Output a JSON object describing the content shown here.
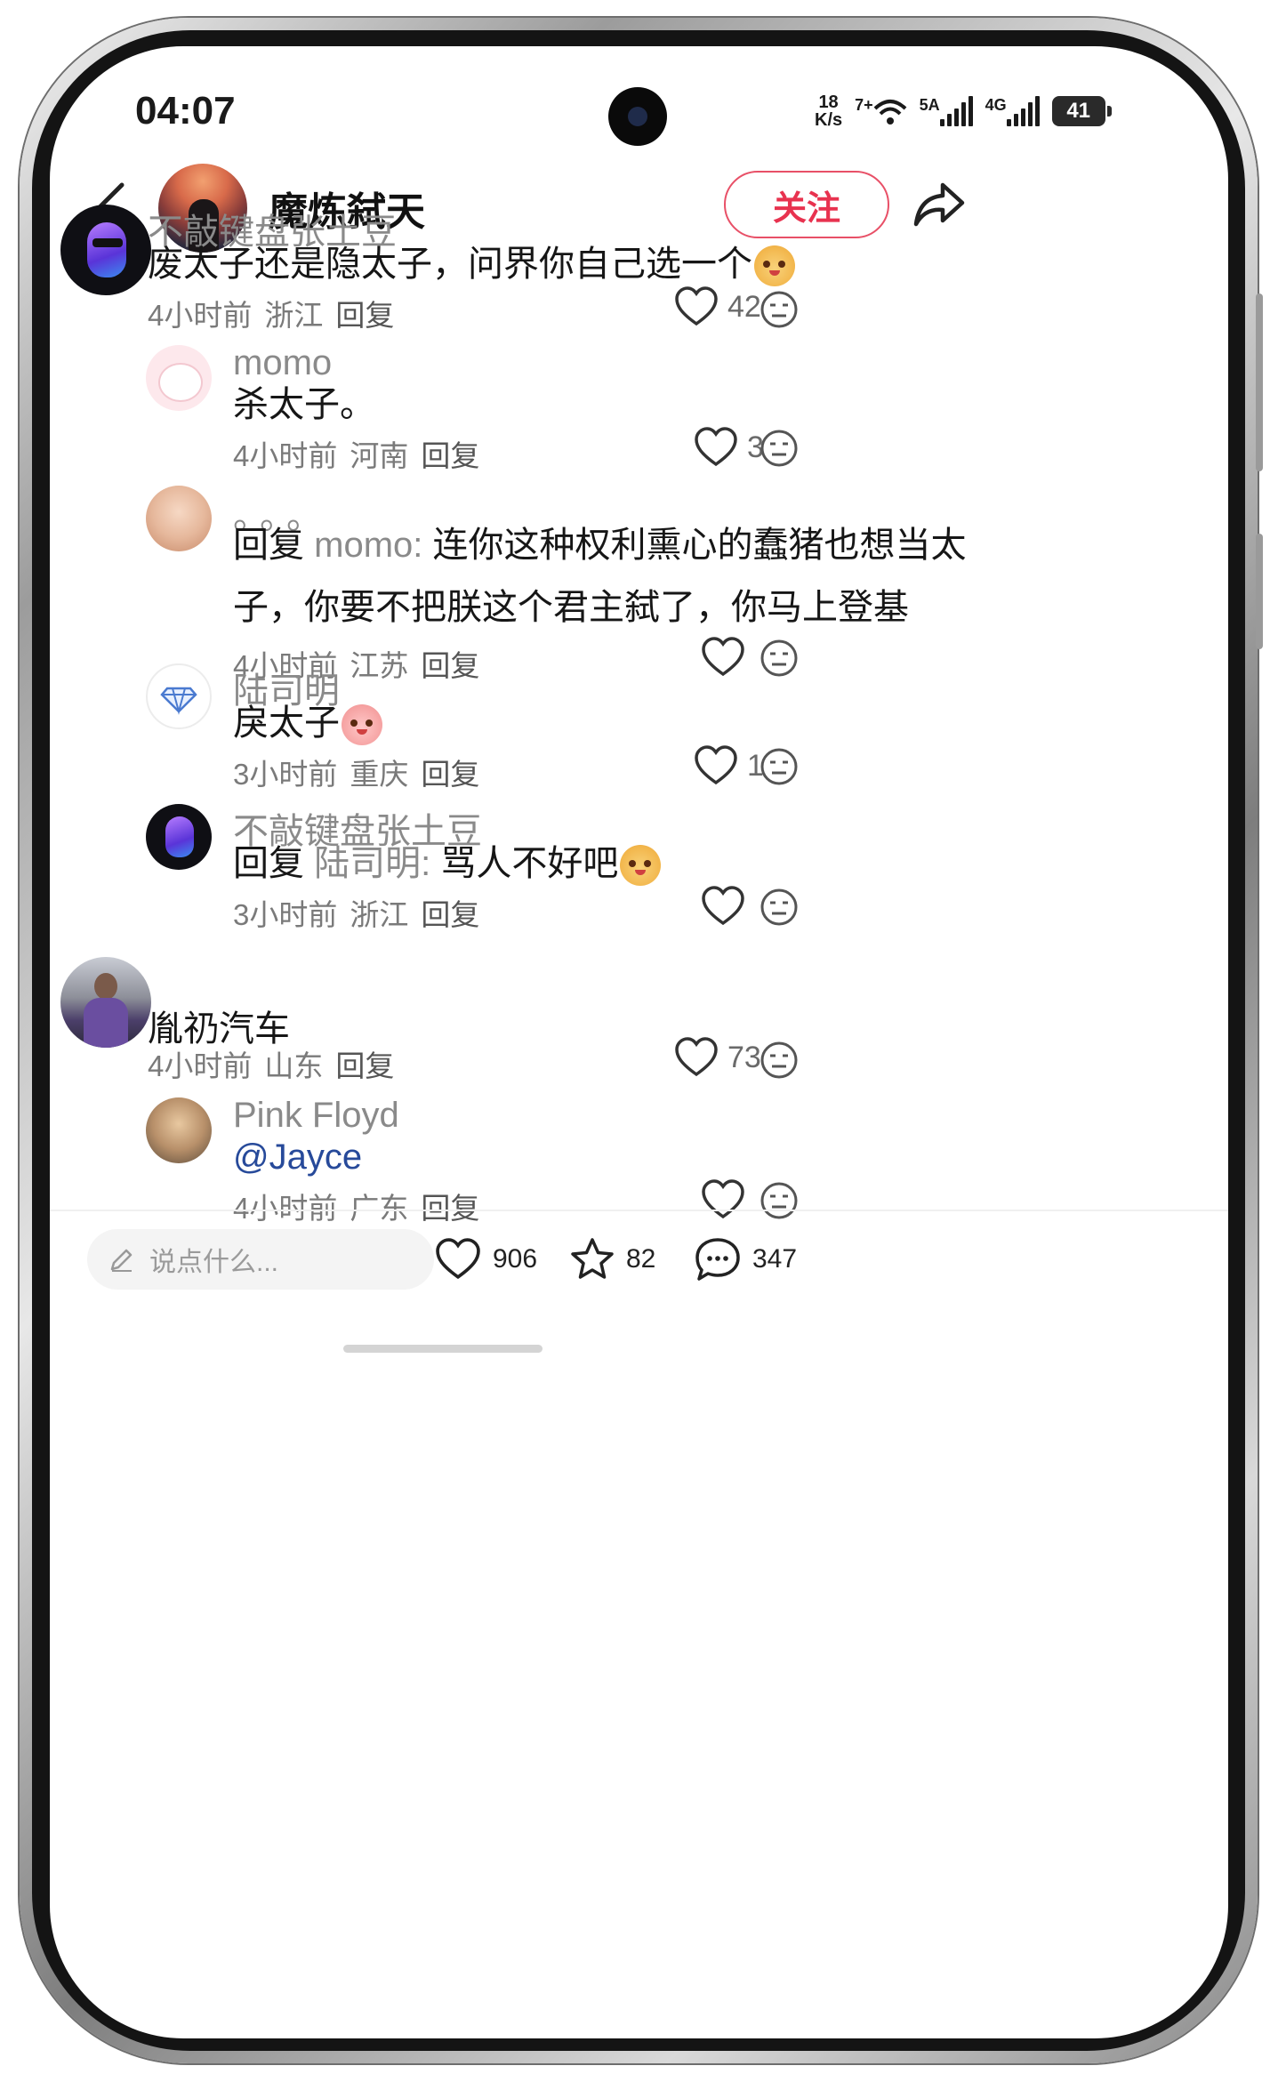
{
  "status_bar": {
    "time": "04:07",
    "net_speed_value": "18",
    "net_speed_unit": "K/s",
    "wifi_label": "7+",
    "sim1_label": "5A",
    "sim2_label": "4G",
    "battery": "41"
  },
  "header": {
    "author_name": "魔炼弑天",
    "follow_label": "关注"
  },
  "comments": [
    {
      "user": "不敲键盘张土豆",
      "text": "废太子还是隐太子，问界你自己选一个",
      "time": "4小时前",
      "location": "浙江",
      "reply_label": "回复",
      "likes": "42"
    },
    {
      "user": "momo",
      "text": "杀太子。",
      "time": "4小时前",
      "location": "河南",
      "reply_label": "回复",
      "likes": "3"
    },
    {
      "user": "。。。",
      "reply_prefix": "回复",
      "reply_to": "momo",
      "line1": "连你这种权利熏心的蠢猪也想当太",
      "line2": "子，你要不把朕这个君主弑了，你马上登基",
      "time": "4小时前",
      "location": "江苏",
      "reply_label": "回复",
      "likes": ""
    },
    {
      "user": "陆司明",
      "text": "戾太子",
      "time": "3小时前",
      "location": "重庆",
      "reply_label": "回复",
      "likes": "1"
    },
    {
      "user": "不敲键盘张土豆",
      "reply_prefix": "回复",
      "reply_to": "陆司明",
      "text": "骂人不好吧",
      "time": "3小时前",
      "location": "浙江",
      "reply_label": "回复",
      "likes": ""
    },
    {
      "user": "",
      "text": "胤礽汽车",
      "time": "4小时前",
      "location": "山东",
      "reply_label": "回复",
      "likes": "73"
    },
    {
      "user": "Pink Floyd",
      "text": "@Jayce",
      "time": "4小时前",
      "location": "广东",
      "reply_label": "回复",
      "likes": ""
    }
  ],
  "bottom_bar": {
    "input_placeholder": "说点什么...",
    "like_count": "906",
    "favorite_count": "82",
    "comment_count": "347"
  },
  "colors": {
    "accent": "#e8324f",
    "secondary_text": "#8a8a8a",
    "mention": "#274a9a"
  }
}
